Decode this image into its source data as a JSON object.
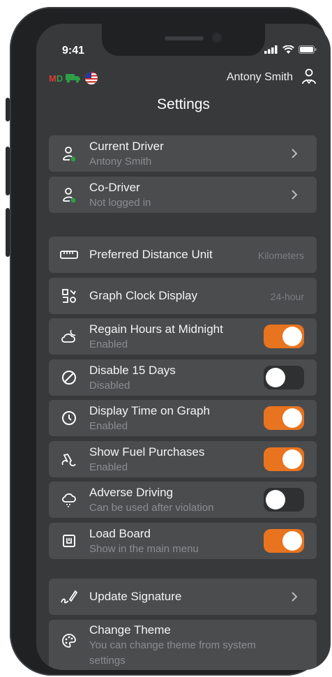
{
  "status": {
    "time": "9:41"
  },
  "topbar": {
    "badge_m": "M",
    "badge_d": "D",
    "user_name": "Antony Smith"
  },
  "page": {
    "title": "Settings"
  },
  "drivers": [
    {
      "label": "Current Driver",
      "sub": "Antony Smith"
    },
    {
      "label": "Co-Driver",
      "sub": "Not logged in"
    }
  ],
  "prefs": {
    "distance": {
      "label": "Preferred Distance Unit",
      "value": "Kilometers"
    },
    "clock": {
      "label": "Graph Clock Display",
      "value": "24-hour"
    },
    "regain": {
      "label": "Regain Hours at Midnight",
      "sub": "Enabled",
      "on": true
    },
    "disable15": {
      "label": "Disable 15 Days",
      "sub": "Disabled",
      "on": false
    },
    "display_time": {
      "label": "Display Time on Graph",
      "sub": "Enabled",
      "on": true
    },
    "fuel": {
      "label": "Show Fuel Purchases",
      "sub": "Enabled",
      "on": true
    },
    "adverse": {
      "label": "Adverse Driving",
      "sub": "Can be used after violation",
      "on": false
    },
    "load_board": {
      "label": "Load Board",
      "sub": "Show in the main menu",
      "on": true
    }
  },
  "extra": {
    "signature": {
      "label": "Update Signature"
    },
    "theme": {
      "label": "Change Theme",
      "sub_line1": "You can change theme from system",
      "sub_line2": "settings"
    }
  },
  "colors": {
    "accent": "#e8741f",
    "card": "#4a4c4e",
    "screen": "#37393b",
    "online": "#2e9e47"
  }
}
